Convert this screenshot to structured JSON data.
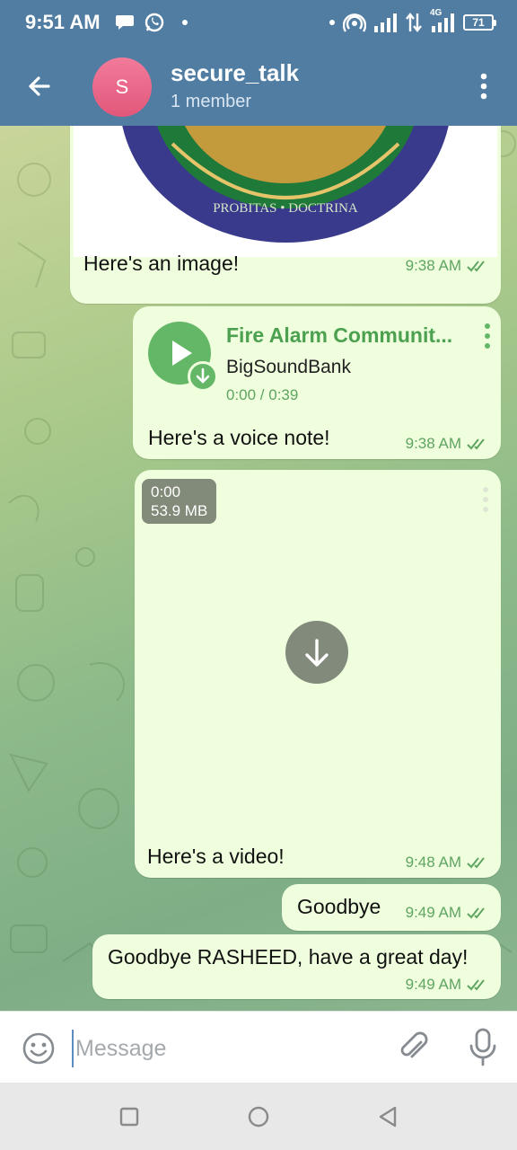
{
  "status_bar": {
    "time": "9:51 AM",
    "left_icons": [
      "chat-bubble-icon",
      "whatsapp-icon",
      "dot-icon"
    ],
    "right_icons": [
      "dot-icon",
      "hotspot-icon",
      "signal-icon",
      "data-arrows-icon",
      "4g-signal-icon",
      "battery-icon"
    ],
    "network": "4G",
    "battery": "71"
  },
  "header": {
    "avatar_letter": "S",
    "title": "secure_talk",
    "subtitle": "1 member",
    "icons": [
      "back-arrow-icon",
      "more-vertical-icon"
    ]
  },
  "messages": [
    {
      "type": "image",
      "caption": "Here's an image!",
      "time": "9:38 AM",
      "read": true,
      "image_text": "PROBITAS • DOCTRINA"
    },
    {
      "type": "audio",
      "title": "Fire Alarm Communit...",
      "artist": "BigSoundBank",
      "progress": "0:00 / 0:39",
      "caption": "Here's a voice note!",
      "time": "9:38 AM",
      "read": true
    },
    {
      "type": "video",
      "duration": "0:00",
      "size": "53.9 MB",
      "caption": "Here's a video!",
      "time": "9:48 AM",
      "read": true
    },
    {
      "type": "text",
      "text": "Goodbye",
      "time": "9:49 AM",
      "read": true
    },
    {
      "type": "text",
      "text": "Goodbye RASHEED, have a great day!",
      "time": "9:49 AM",
      "read": true
    }
  ],
  "input": {
    "placeholder": "Message",
    "icons": [
      "emoji-icon",
      "attach-icon",
      "mic-icon"
    ]
  },
  "nav": {
    "icons": [
      "recents-square-icon",
      "home-circle-icon",
      "back-triangle-icon"
    ]
  },
  "colors": {
    "header": "#517da2",
    "bubble_out": "#effedd",
    "accent_green": "#63b767",
    "time_green": "#5fa561",
    "avatar": "#e2577b"
  }
}
